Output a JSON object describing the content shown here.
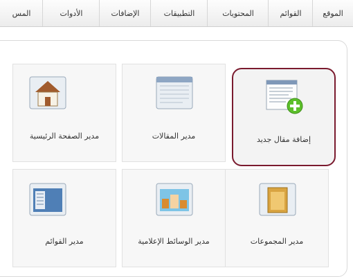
{
  "menu": [
    "الموقع",
    "القوائم",
    "المحتويات",
    "التطبيقات",
    "الإضافات",
    "الأدوات",
    "المس"
  ],
  "tiles": [
    {
      "label": "إضافة مقال جديد",
      "icon": "article-add-icon"
    },
    {
      "label": "مدير المقالات",
      "icon": "article-manager-icon"
    },
    {
      "label": "مدير الصفحة الرئيسية",
      "icon": "home-icon"
    },
    {
      "label": "مدير المجموعات",
      "icon": "folder-icon"
    },
    {
      "label": "مدير الوسائط الإعلامية",
      "icon": "media-icon"
    },
    {
      "label": "مدير القوائم",
      "icon": "menu-manager-icon"
    }
  ]
}
